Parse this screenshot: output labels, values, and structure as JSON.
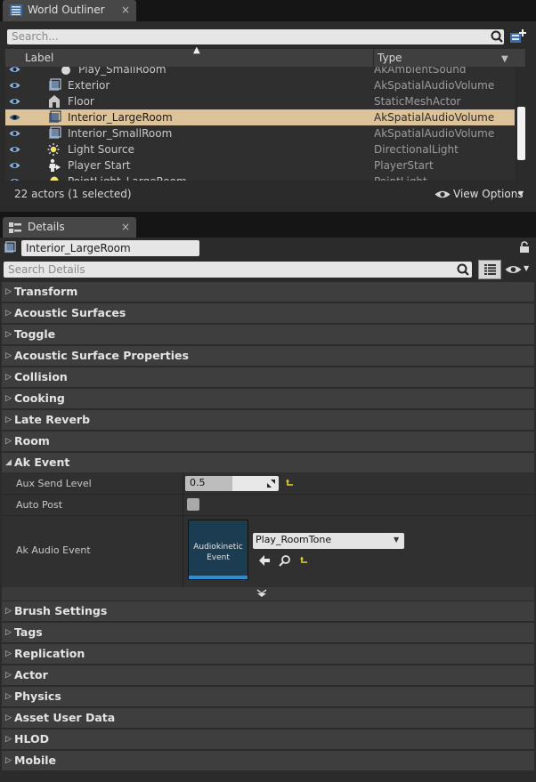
{
  "outliner": {
    "tab_label": "World Outliner",
    "close_glyph": "×",
    "search_placeholder": "Search...",
    "columns": {
      "label": "Label",
      "type": "Type"
    },
    "rows": [
      {
        "label": "Play_SmallRoom",
        "type": "AkAmbientSound",
        "icon": "sphere-icon",
        "selected": false
      },
      {
        "label": "Exterior",
        "type": "AkSpatialAudioVolume",
        "icon": "volume-icon",
        "selected": false
      },
      {
        "label": "Floor",
        "type": "StaticMeshActor",
        "icon": "mesh-icon",
        "selected": false
      },
      {
        "label": "Interior_LargeRoom",
        "type": "AkSpatialAudioVolume",
        "icon": "volume-icon",
        "selected": true
      },
      {
        "label": "Interior_SmallRoom",
        "type": "AkSpatialAudioVolume",
        "icon": "volume-icon",
        "selected": false
      },
      {
        "label": "Light Source",
        "type": "DirectionalLight",
        "icon": "sun-icon",
        "selected": false
      },
      {
        "label": "Player Start",
        "type": "PlayerStart",
        "icon": "player-start-icon",
        "selected": false
      },
      {
        "label": "PointLight_LargeRoom",
        "type": "PointLight",
        "icon": "bulb-icon",
        "selected": false
      }
    ],
    "status": "22 actors (1 selected)",
    "view_options": "View Options"
  },
  "details": {
    "tab_label": "Details",
    "close_glyph": "×",
    "name_value": "Interior_LargeRoom",
    "search_placeholder": "Search Details",
    "categories_top": [
      "Transform",
      "Acoustic Surfaces",
      "Toggle",
      "Acoustic Surface Properties",
      "Collision",
      "Cooking",
      "Late Reverb",
      "Room"
    ],
    "ak_event": {
      "label": "Ak Event",
      "aux_send_label": "Aux Send Level",
      "aux_send_value": "0.5",
      "aux_send_fraction": 0.5,
      "auto_post_label": "Auto Post",
      "auto_post_checked": false,
      "audio_event_label": "Ak Audio Event",
      "thumb_line1": "Audiokinetic",
      "thumb_line2": "Event",
      "event_value": "Play_RoomTone"
    },
    "categories_bottom": [
      "Brush Settings",
      "Tags",
      "Replication",
      "Actor",
      "Physics",
      "Asset User Data",
      "HLOD",
      "Mobile"
    ]
  },
  "colors": {
    "selection": "#ddc39a",
    "reset_arrow": "#e8d62c",
    "thumb_bar": "#2a8fd0",
    "thumb_bg": "#1c3c52"
  }
}
